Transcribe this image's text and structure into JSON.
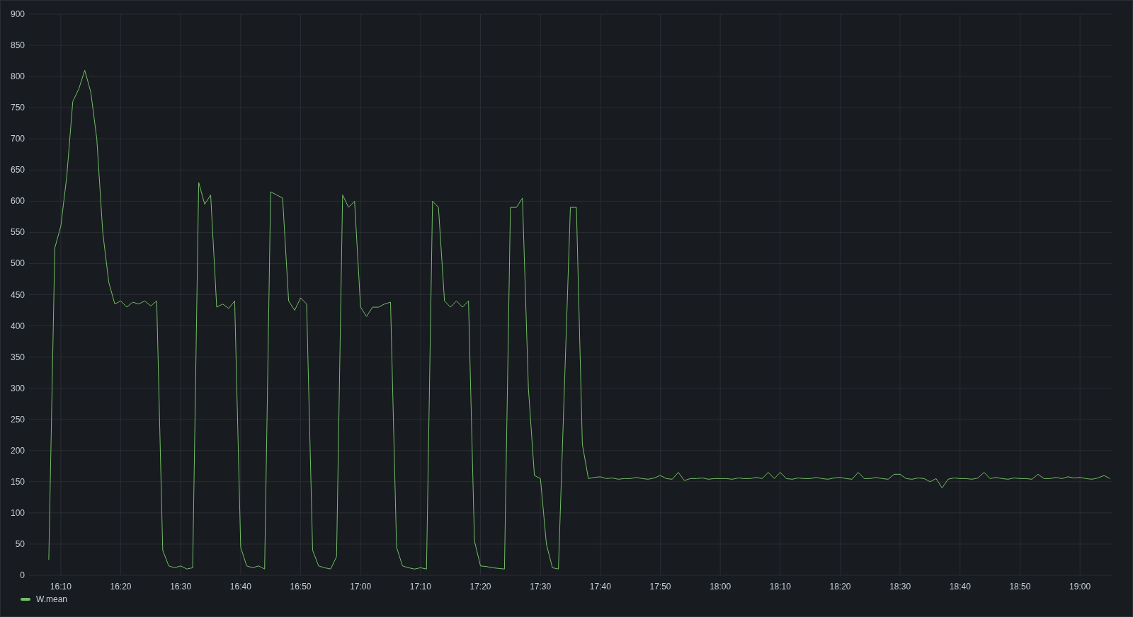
{
  "panel": {
    "chart_data": {
      "type": "line",
      "grid": true,
      "categories": [
        null,
        null,
        null,
        null,
        null,
        "16:10",
        null,
        null,
        null,
        null,
        null,
        null,
        null,
        null,
        null,
        "16:20",
        null,
        null,
        null,
        null,
        null,
        null,
        null,
        null,
        null,
        "16:30",
        null,
        null,
        null,
        null,
        null,
        null,
        null,
        null,
        null,
        "16:40",
        null,
        null,
        null,
        null,
        null,
        null,
        null,
        null,
        null,
        "16:50",
        null,
        null,
        null,
        null,
        null,
        null,
        null,
        null,
        null,
        "17:00",
        null,
        null,
        null,
        null,
        null,
        null,
        null,
        null,
        null,
        "17:10",
        null,
        null,
        null,
        null,
        null,
        null,
        null,
        null,
        null,
        "17:20",
        null,
        null,
        null,
        null,
        null,
        null,
        null,
        null,
        null,
        "17:30",
        null,
        null,
        null,
        null,
        null,
        null,
        null,
        null,
        null,
        "17:40",
        null,
        null,
        null,
        null,
        null,
        null,
        null,
        null,
        null,
        "17:50",
        null,
        null,
        null,
        null,
        null,
        null,
        null,
        null,
        null,
        "18:00",
        null,
        null,
        null,
        null,
        null,
        null,
        null,
        null,
        null,
        "18:10",
        null,
        null,
        null,
        null,
        null,
        null,
        null,
        null,
        null,
        "18:20",
        null,
        null,
        null,
        null,
        null,
        null,
        null,
        null,
        null,
        "18:30",
        null,
        null,
        null,
        null,
        null,
        null,
        null,
        null,
        null,
        "18:40",
        null,
        null,
        null,
        null,
        null,
        null,
        null,
        null,
        null,
        "18:50",
        null,
        null,
        null,
        null,
        null,
        null,
        null,
        null,
        null,
        "19:00",
        null,
        null,
        null,
        null,
        null
      ],
      "series": [
        {
          "name": "W.mean",
          "color": "#73bf69",
          "values": [
            null,
            null,
            null,
            25,
            525,
            560,
            640,
            760,
            780,
            810,
            775,
            700,
            550,
            470,
            435,
            440,
            430,
            438,
            435,
            440,
            432,
            440,
            40,
            15,
            12,
            15,
            10,
            12,
            630,
            595,
            610,
            430,
            435,
            428,
            440,
            45,
            15,
            12,
            15,
            10,
            615,
            610,
            605,
            440,
            425,
            445,
            435,
            40,
            15,
            12,
            10,
            30,
            610,
            590,
            600,
            430,
            415,
            430,
            430,
            435,
            438,
            45,
            15,
            12,
            10,
            12,
            10,
            600,
            590,
            440,
            430,
            440,
            430,
            440,
            55,
            15,
            14,
            12,
            11,
            10,
            590,
            590,
            605,
            300,
            160,
            155,
            50,
            12,
            10,
            300,
            590,
            590,
            210,
            155,
            157,
            158,
            155,
            156,
            154,
            155,
            155,
            157,
            155,
            154,
            156,
            160,
            155,
            154,
            165,
            152,
            155,
            155,
            156,
            154,
            155,
            155,
            155,
            154,
            156,
            155,
            155,
            157,
            155,
            165,
            155,
            165,
            155,
            154,
            156,
            155,
            155,
            157,
            155,
            154,
            156,
            157,
            155,
            154,
            165,
            155,
            155,
            157,
            155,
            154,
            162,
            162,
            155,
            154,
            156,
            155,
            150,
            155,
            140,
            154,
            156,
            155,
            155,
            154,
            156,
            165,
            155,
            157,
            155,
            154,
            156,
            155,
            155,
            154,
            162,
            155,
            155,
            157,
            155,
            158,
            156,
            157,
            155,
            154,
            156,
            160,
            155
          ]
        }
      ],
      "ylim": [
        0,
        900
      ],
      "yticks": [
        0,
        50,
        100,
        150,
        200,
        250,
        300,
        350,
        400,
        450,
        500,
        550,
        600,
        650,
        700,
        750,
        800,
        850,
        900
      ]
    }
  }
}
